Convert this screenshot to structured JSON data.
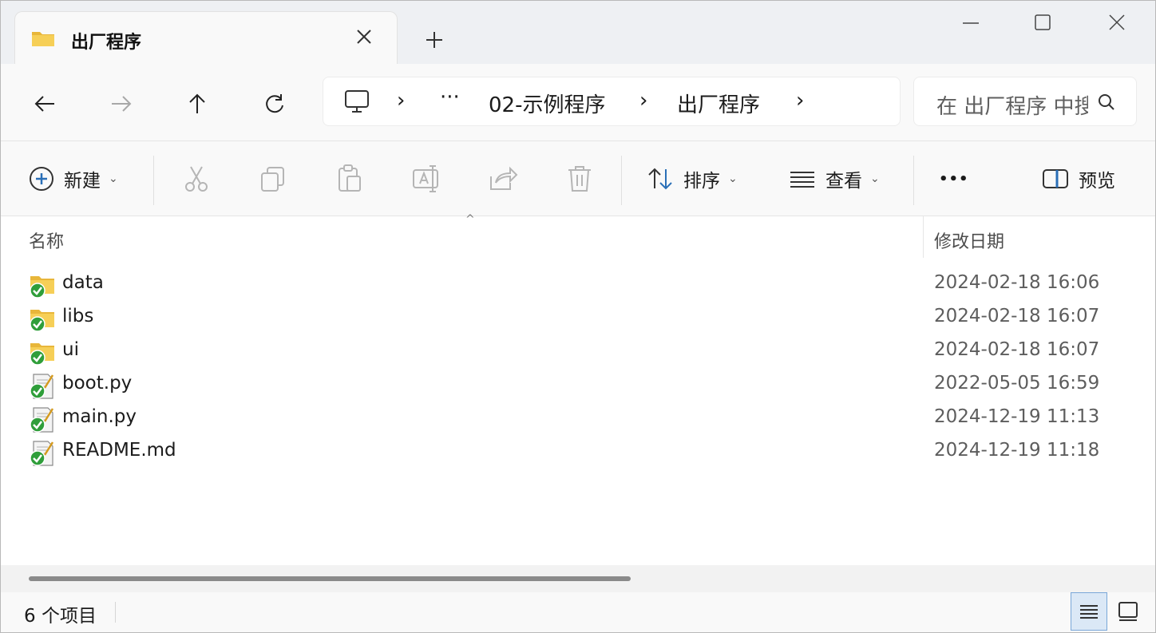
{
  "tab": {
    "title": "出厂程序",
    "icon": "folder-icon"
  },
  "window_controls": {
    "minimize": "minimize-icon",
    "maximize": "maximize-icon",
    "close": "close-icon"
  },
  "navigation": {
    "buttons": [
      "back-arrow-icon",
      "forward-arrow-icon",
      "up-arrow-icon",
      "refresh-icon"
    ],
    "forward_disabled": true
  },
  "address_bar": {
    "ellipsis": "···",
    "segments": [
      "02-示例程序",
      "出厂程序"
    ],
    "separator": "›"
  },
  "search": {
    "placeholder": "在 出厂程序 中搜索"
  },
  "command_bar": {
    "new_label": "新建",
    "sort_label": "排序",
    "view_label": "查看",
    "more_label": "•••",
    "preview_label": "预览",
    "disabled_actions": [
      "cut-icon",
      "copy-icon",
      "paste-icon",
      "rename-icon",
      "share-icon",
      "delete-icon"
    ]
  },
  "columns": {
    "name": "名称",
    "modified": "修改日期"
  },
  "files": [
    {
      "name": "data",
      "type": "folder",
      "modified": "2024-02-18 16:06"
    },
    {
      "name": "libs",
      "type": "folder",
      "modified": "2024-02-18 16:07"
    },
    {
      "name": "ui",
      "type": "folder",
      "modified": "2024-02-18 16:07"
    },
    {
      "name": "boot.py",
      "type": "file",
      "modified": "2022-05-05 16:59"
    },
    {
      "name": "main.py",
      "type": "file",
      "modified": "2024-12-19 11:13"
    },
    {
      "name": "README.md",
      "type": "file",
      "modified": "2024-12-19 11:18"
    }
  ],
  "status": {
    "item_count": "6 个项目"
  },
  "colors": {
    "accent": "#2a6fb7",
    "sync_green": "#2f9e3a",
    "folder_yellow": "#f3c647"
  }
}
